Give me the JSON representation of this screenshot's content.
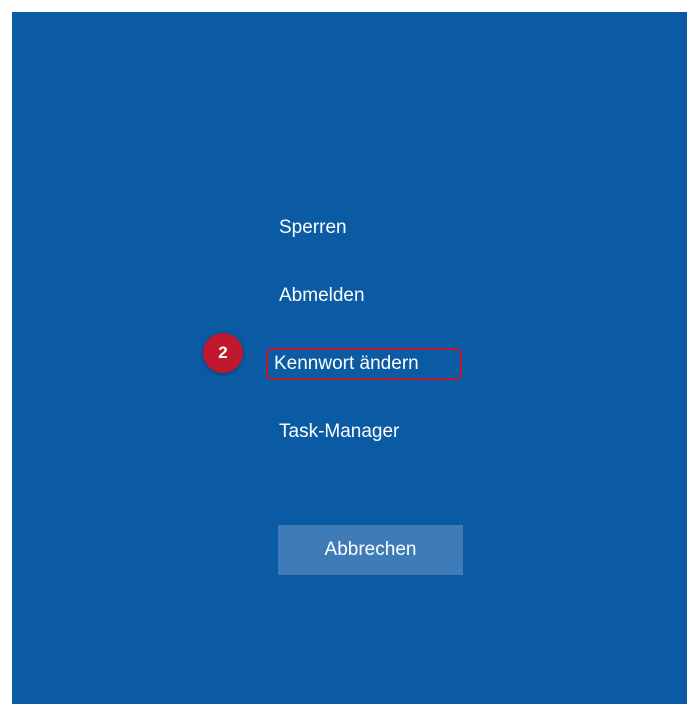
{
  "menu": {
    "lock_label": "Sperren",
    "signout_label": "Abmelden",
    "change_password_label": "Kennwort ändern",
    "task_manager_label": "Task-Manager"
  },
  "annotation": {
    "step_number": "2"
  },
  "buttons": {
    "cancel_label": "Abbrechen"
  },
  "colors": {
    "background": "#0a5aa4",
    "button": "#3f7bb7",
    "highlight": "#c0192f",
    "text": "#ffffff"
  }
}
